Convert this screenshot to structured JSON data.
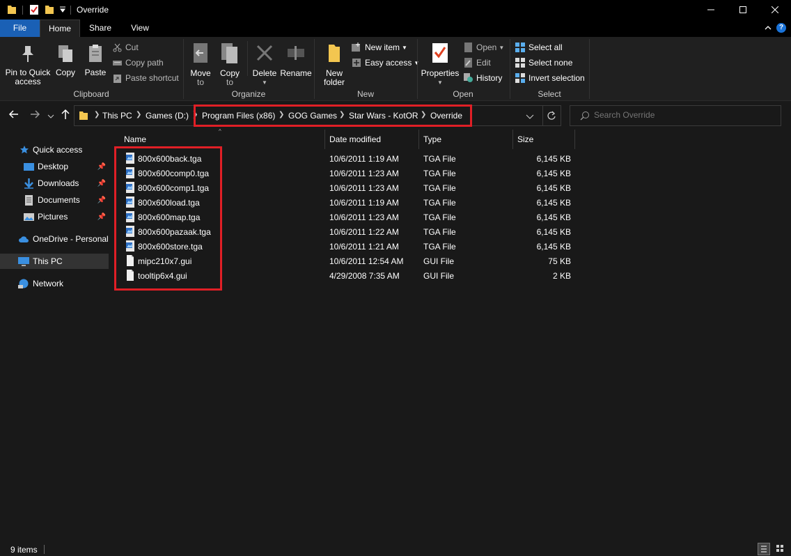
{
  "window": {
    "title": "Override",
    "minimize_icon": "minimize-icon",
    "maximize_icon": "maximize-icon",
    "close_icon": "close-icon"
  },
  "ribbon_tabs": [
    "File",
    "Home",
    "Share",
    "View"
  ],
  "ribbon": {
    "clipboard": {
      "label": "Clipboard",
      "pin_label_1": "Pin to Quick",
      "pin_label_2": "access",
      "copy": "Copy",
      "paste": "Paste",
      "cut": "Cut",
      "copy_path": "Copy path",
      "paste_shortcut": "Paste shortcut"
    },
    "organize": {
      "label": "Organize",
      "move_to_1": "Move",
      "move_to_2": "to",
      "copy_to_1": "Copy",
      "copy_to_2": "to",
      "delete": "Delete",
      "rename": "Rename"
    },
    "new": {
      "label": "New",
      "new_folder_1": "New",
      "new_folder_2": "folder",
      "new_item": "New item",
      "easy_access": "Easy access"
    },
    "open": {
      "label": "Open",
      "properties": "Properties",
      "open": "Open",
      "edit": "Edit",
      "history": "History"
    },
    "select": {
      "label": "Select",
      "select_all": "Select all",
      "select_none": "Select none",
      "invert_selection": "Invert selection"
    }
  },
  "address": {
    "crumbs": [
      "This PC",
      "Games (D:)",
      "Program Files (x86)",
      "GOG Games",
      "Star Wars - KotOR",
      "Override"
    ]
  },
  "search": {
    "placeholder": "Search Override"
  },
  "nav": {
    "quick_access": "Quick access",
    "desktop": "Desktop",
    "downloads": "Downloads",
    "documents": "Documents",
    "pictures": "Pictures",
    "onedrive": "OneDrive - Personal",
    "this_pc": "This PC",
    "network": "Network"
  },
  "columns": {
    "name": "Name",
    "date": "Date modified",
    "type": "Type",
    "size": "Size"
  },
  "files": [
    {
      "name": "800x600back.tga",
      "date": "10/6/2011 1:19 AM",
      "type": "TGA File",
      "size": "6,145 KB",
      "icon": "tga"
    },
    {
      "name": "800x600comp0.tga",
      "date": "10/6/2011 1:23 AM",
      "type": "TGA File",
      "size": "6,145 KB",
      "icon": "tga"
    },
    {
      "name": "800x600comp1.tga",
      "date": "10/6/2011 1:23 AM",
      "type": "TGA File",
      "size": "6,145 KB",
      "icon": "tga"
    },
    {
      "name": "800x600load.tga",
      "date": "10/6/2011 1:19 AM",
      "type": "TGA File",
      "size": "6,145 KB",
      "icon": "tga"
    },
    {
      "name": "800x600map.tga",
      "date": "10/6/2011 1:23 AM",
      "type": "TGA File",
      "size": "6,145 KB",
      "icon": "tga"
    },
    {
      "name": "800x600pazaak.tga",
      "date": "10/6/2011 1:22 AM",
      "type": "TGA File",
      "size": "6,145 KB",
      "icon": "tga"
    },
    {
      "name": "800x600store.tga",
      "date": "10/6/2011 1:21 AM",
      "type": "TGA File",
      "size": "6,145 KB",
      "icon": "tga"
    },
    {
      "name": "mipc210x7.gui",
      "date": "10/6/2011 12:54 AM",
      "type": "GUI File",
      "size": "75 KB",
      "icon": "gui"
    },
    {
      "name": "tooltip6x4.gui",
      "date": "4/29/2008 7:35 AM",
      "type": "GUI File",
      "size": "2 KB",
      "icon": "gui"
    }
  ],
  "status": {
    "item_count": "9 items"
  },
  "colors": {
    "highlight": "#e01f26",
    "file_tab": "#1a60b5"
  }
}
